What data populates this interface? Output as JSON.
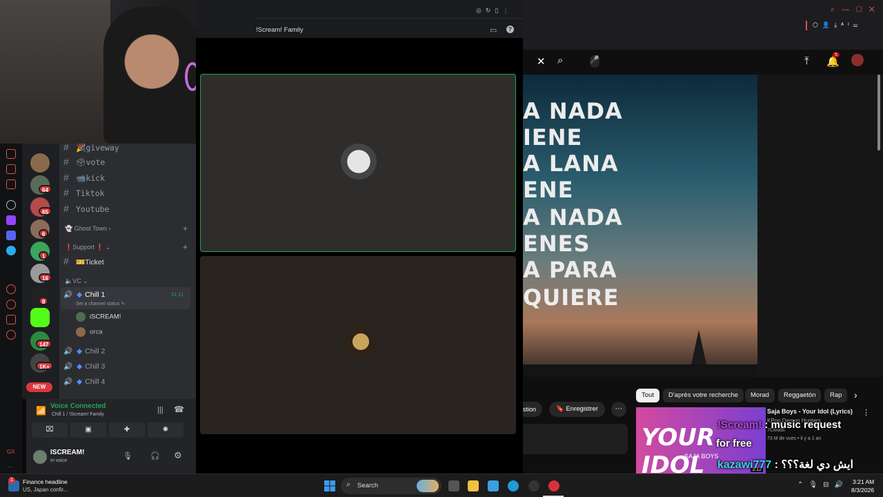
{
  "discord": {
    "server_title": "!Scream! Family",
    "channels": [
      {
        "name": "🎉giveway"
      },
      {
        "name": "🗳vote"
      },
      {
        "name": "📹kick"
      },
      {
        "name": "Tiktok"
      },
      {
        "name": "Youtube"
      }
    ],
    "categories": {
      "ghost_town": "👻 Ghost Town ›",
      "support": "❗Support ❗ ⌄",
      "vc": "🔈VC ⌄"
    },
    "ticket_channel": "🎫Ticket",
    "voice_channels": [
      {
        "name": "Chill 1",
        "timer": "31:11",
        "status_hint": "Set a channel status ✎"
      },
      {
        "name": "Chill 2"
      },
      {
        "name": "Chill 3"
      },
      {
        "name": "Chill 4"
      }
    ],
    "voice_users": [
      "iSCREAM!",
      "orca"
    ],
    "server_badges": [
      "64",
      "65",
      "6",
      "1",
      "16",
      "8",
      "147",
      "1K+"
    ],
    "new_badge": "NEW",
    "voice_connected": "Voice Connected",
    "voice_location": "Chill 1 / !Scream! Family",
    "user": {
      "name": "ISCREAM!",
      "status": "In voice"
    }
  },
  "youtube": {
    "lyrics": [
      "A NADA",
      "IENE",
      "A LANA",
      "ENE",
      "A NADA",
      "ENES",
      "A PARA",
      "QUIERE"
    ],
    "notification_count": "5",
    "chips": [
      "Tout",
      "D'après votre recherche",
      "Morad",
      "Reggaetón",
      "Rap"
    ],
    "question_label": "stion",
    "save_label": "Enregistrer",
    "rec": {
      "title": "Saja Boys - Your Idol (Lyrics)",
      "channel": "KPop Demon Hunters",
      "channel2": "7Clouds",
      "meta": "73 M de vues • il y a 1 an",
      "duration": "3:12",
      "thumb_text": "YOUR IDOL",
      "thumb_sub": "SAJA BOYS"
    }
  },
  "stream_overlay": {
    "line1_user": "!Scream!",
    "line1_msg": " : music request",
    "line1_tail": "for free",
    "line2_user": "kazawi777",
    "line2_msg": " : ايش دي لغة؟؟؟"
  },
  "taskbar": {
    "news_title": "Finance headline",
    "news_sub": "US, Japan confir...",
    "search_placeholder": "Search",
    "time": "3:21 AM",
    "date": "8/3/2026",
    "tray_badge": "1"
  }
}
